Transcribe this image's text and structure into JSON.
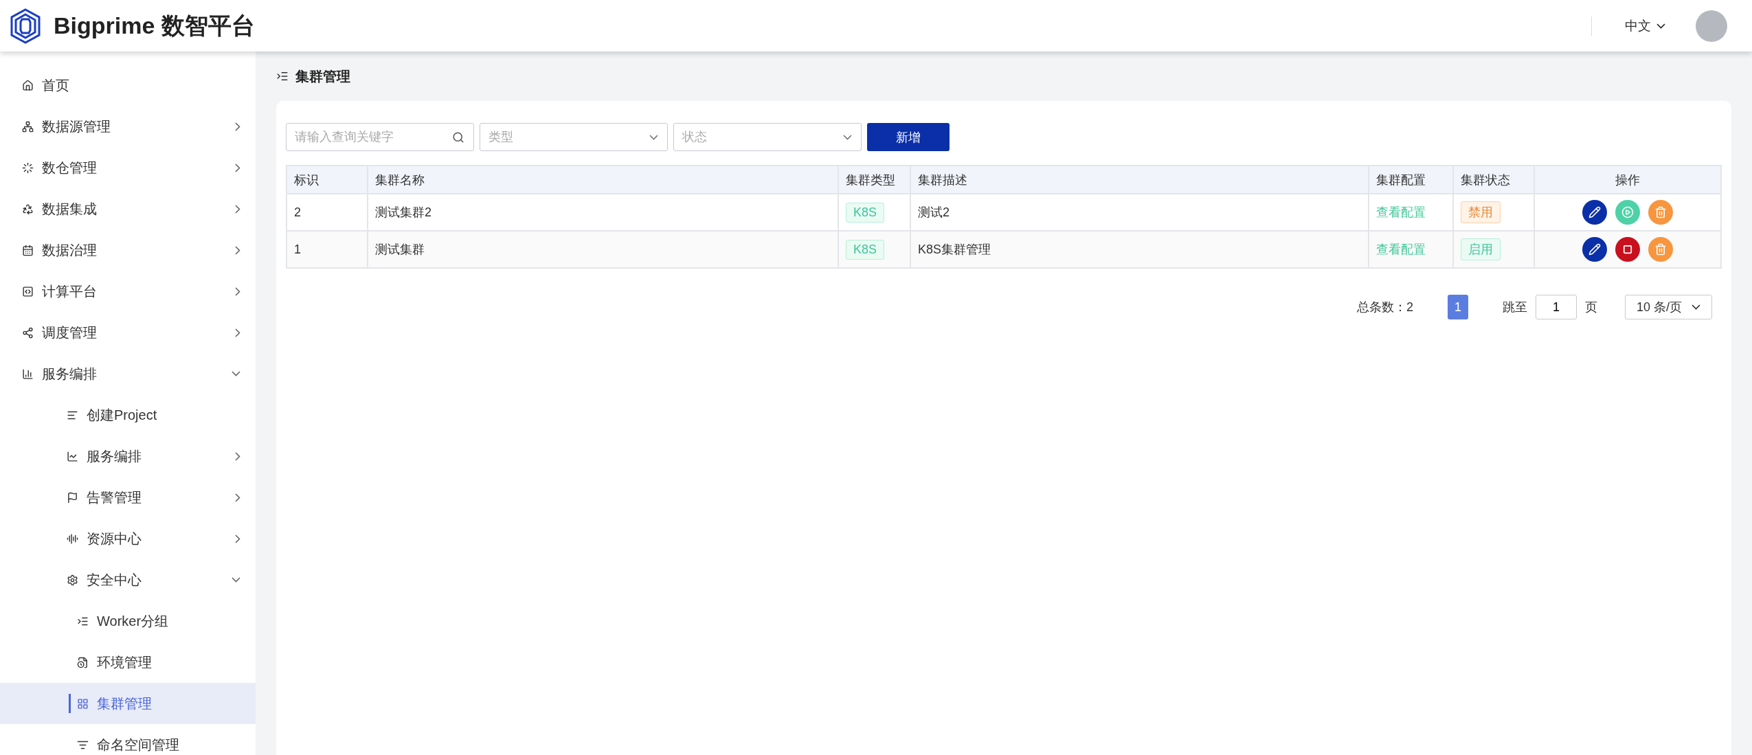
{
  "header": {
    "brand": "Bigprime 数智平台",
    "language": "中文"
  },
  "sidebar": {
    "items": [
      {
        "label": "首页",
        "selected": false
      },
      {
        "label": "数据源管理",
        "expanded": false,
        "selected": false
      },
      {
        "label": "数仓管理",
        "expanded": false,
        "selected": false
      },
      {
        "label": "数据集成",
        "expanded": false,
        "selected": false
      },
      {
        "label": "数据治理",
        "expanded": false,
        "selected": false
      },
      {
        "label": "计算平台",
        "expanded": false,
        "selected": false
      },
      {
        "label": "调度管理",
        "expanded": false,
        "selected": false
      },
      {
        "label": "服务编排",
        "expanded": true,
        "selected": false,
        "children": [
          {
            "label": "创建Project",
            "selected": false
          },
          {
            "label": "服务编排",
            "expanded": false,
            "selected": false
          },
          {
            "label": "告警管理",
            "expanded": false,
            "selected": false
          },
          {
            "label": "资源中心",
            "expanded": false,
            "selected": false
          },
          {
            "label": "安全中心",
            "expanded": true,
            "selected": false,
            "children": [
              {
                "label": "Worker分组",
                "selected": false
              },
              {
                "label": "环境管理",
                "selected": false
              },
              {
                "label": "集群管理",
                "selected": true
              },
              {
                "label": "命名空间管理",
                "selected": false
              }
            ]
          }
        ]
      }
    ]
  },
  "page_title": "集群管理",
  "toolbar": {
    "search": {
      "placeholder": "请输入查询关键字"
    },
    "type_select": {
      "placeholder": "类型"
    },
    "status_select": {
      "placeholder": "状态"
    },
    "add_button": "新增"
  },
  "table": {
    "columns": [
      "标识",
      "集群名称",
      "集群类型",
      "集群描述",
      "集群配置",
      "集群状态",
      "操作"
    ],
    "rows": [
      {
        "id": "2",
        "name": "测试集群2",
        "type": "K8S",
        "description": "测试2",
        "config": "查看配置",
        "status": {
          "label": "禁用",
          "kind": "disabled"
        },
        "actions": [
          {
            "kind": "edit"
          },
          {
            "kind": "start"
          },
          {
            "kind": "delete"
          }
        ]
      },
      {
        "id": "1",
        "name": "测试集群",
        "type": "K8S",
        "description": "K8S集群管理",
        "config": "查看配置",
        "status": {
          "label": "启用",
          "kind": "enabled"
        },
        "actions": [
          {
            "kind": "edit"
          },
          {
            "kind": "stop"
          },
          {
            "kind": "delete"
          }
        ]
      }
    ]
  },
  "pagination": {
    "total": "总条数：2",
    "pages": [
      {
        "label": "1",
        "selected": true
      }
    ],
    "jump_label": "跳至",
    "jump_value": "1",
    "page_unit": "页",
    "page_size": "10 条/页"
  }
}
